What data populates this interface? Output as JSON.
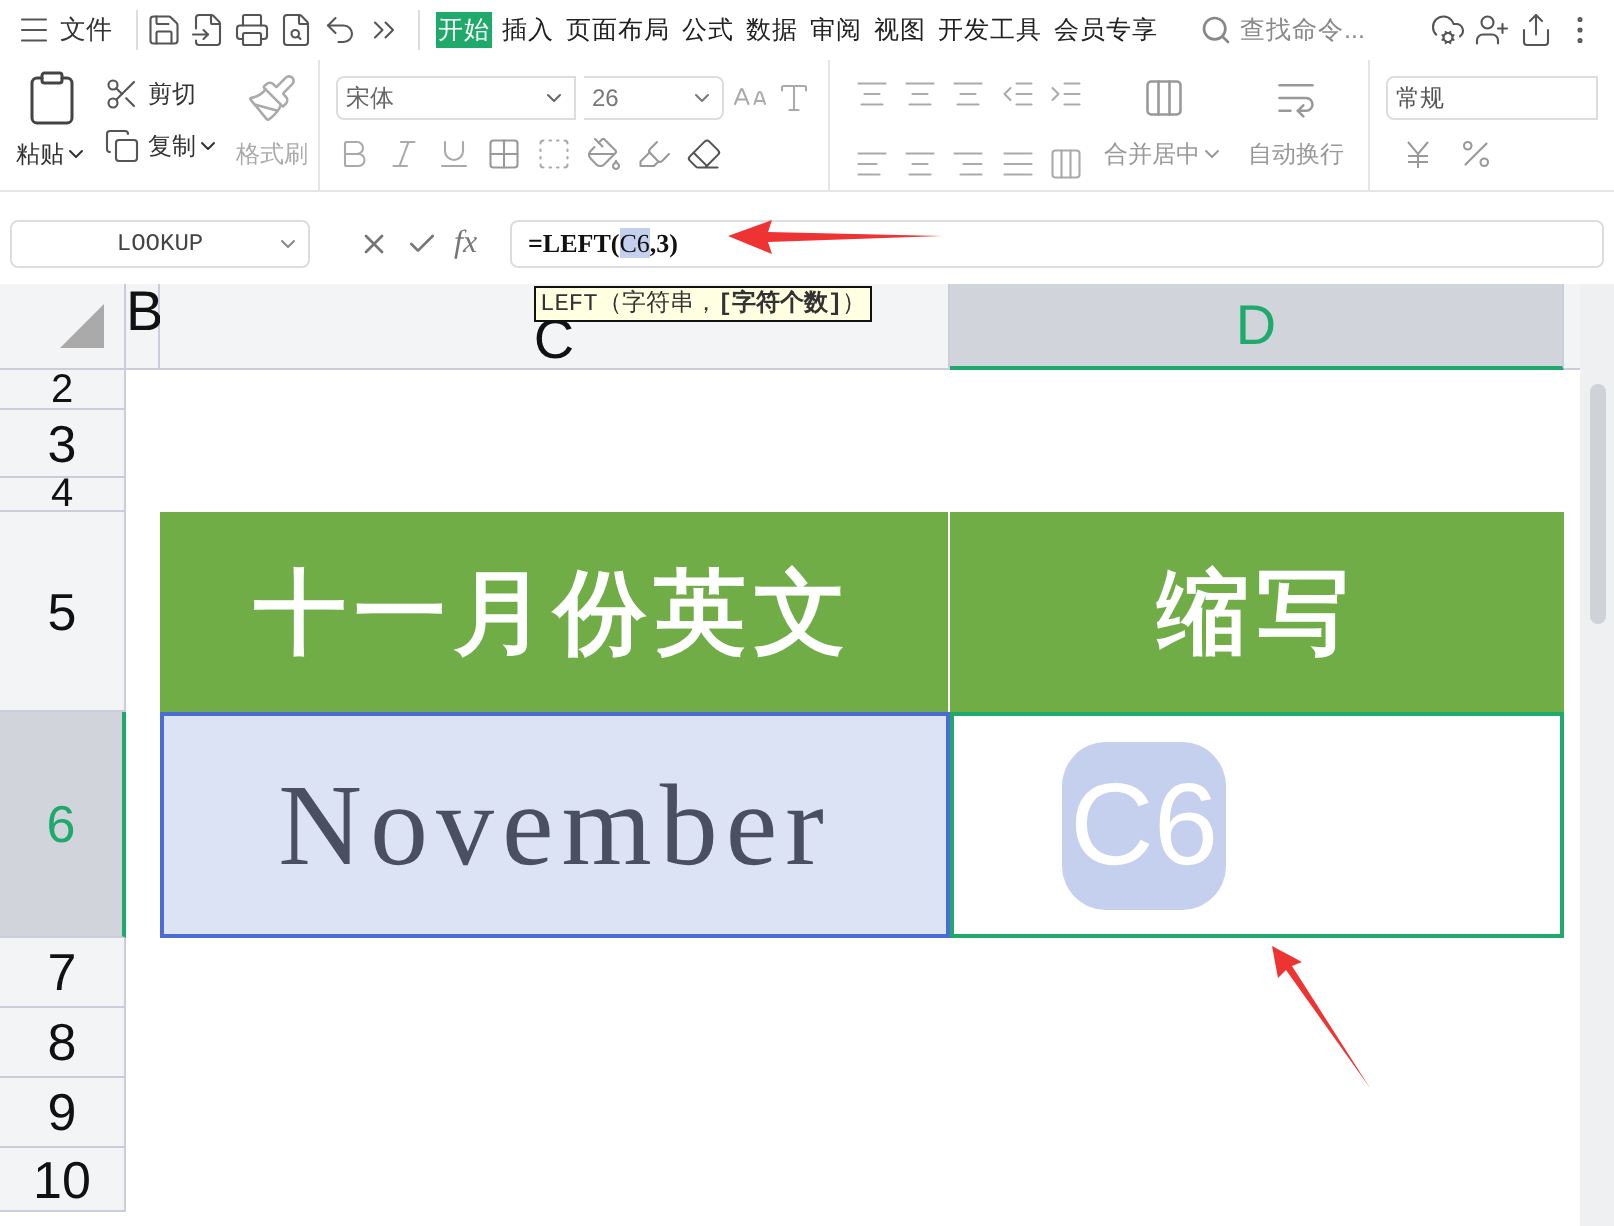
{
  "menu": {
    "file": "文件",
    "tabs": [
      {
        "label": "开始",
        "selected": true
      },
      {
        "label": "插入",
        "selected": false
      },
      {
        "label": "页面布局",
        "selected": false
      },
      {
        "label": "公式",
        "selected": false
      },
      {
        "label": "数据",
        "selected": false
      },
      {
        "label": "审阅",
        "selected": false
      },
      {
        "label": "视图",
        "selected": false
      },
      {
        "label": "开发工具",
        "selected": false
      },
      {
        "label": "会员专享",
        "selected": false
      }
    ],
    "search": {
      "placeholder": "查找命令..."
    }
  },
  "ribbon": {
    "paste": "粘贴",
    "cut": "剪切",
    "copy": "复制",
    "format_painter": {
      "label": "格式刷",
      "disabled": true
    },
    "font": {
      "value": "宋体"
    },
    "font_size": {
      "value": "26"
    },
    "merge": "合并居中",
    "wrap": "自动换行",
    "number_format": {
      "value": "常规"
    }
  },
  "formula_bar": {
    "name_box": "LOOKUP",
    "fx": "fx",
    "formula": {
      "before": "=LEFT(",
      "reference": "C6",
      "after": ",3)"
    }
  },
  "tooltip": "LEFT（字符串，**[字符个数]**）",
  "columns": [
    {
      "label": "B",
      "selected": false
    },
    {
      "label": "C",
      "selected": false
    },
    {
      "label": "D",
      "selected": true
    }
  ],
  "rows": [
    {
      "label": "2",
      "selected": false
    },
    {
      "label": "3",
      "selected": false
    },
    {
      "label": "4",
      "selected": false
    },
    {
      "label": "5",
      "selected": false
    },
    {
      "label": "6",
      "selected": true
    },
    {
      "label": "7",
      "selected": false
    },
    {
      "label": "8",
      "selected": false
    },
    {
      "label": "9",
      "selected": false
    },
    {
      "label": "10",
      "selected": false
    }
  ],
  "cells": {
    "header": [
      "十一月份英文",
      "缩写"
    ],
    "c6": "November",
    "d6": "C6"
  }
}
